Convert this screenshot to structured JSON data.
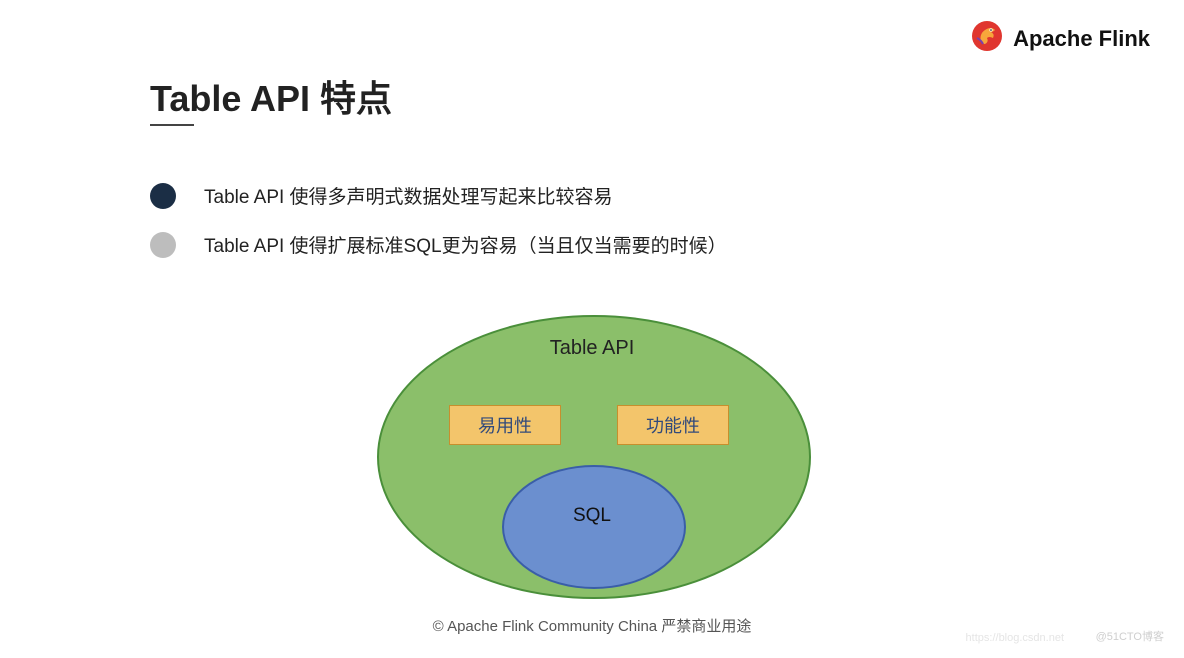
{
  "brand": {
    "name": "Apache Flink"
  },
  "title": "Table API 特点",
  "bullets": [
    "Table API 使得多声明式数据处理写起来比较容易",
    "Table API 使得扩展标准SQL更为容易（当且仅当需要的时候）"
  ],
  "diagram": {
    "outer_label": "Table API",
    "box_left": "易用性",
    "box_right": "功能性",
    "inner_label": "SQL"
  },
  "footer": "© Apache Flink Community China  严禁商业用途",
  "watermark_left": "https://blog.csdn.net",
  "watermark_right": "@51CTO博客"
}
